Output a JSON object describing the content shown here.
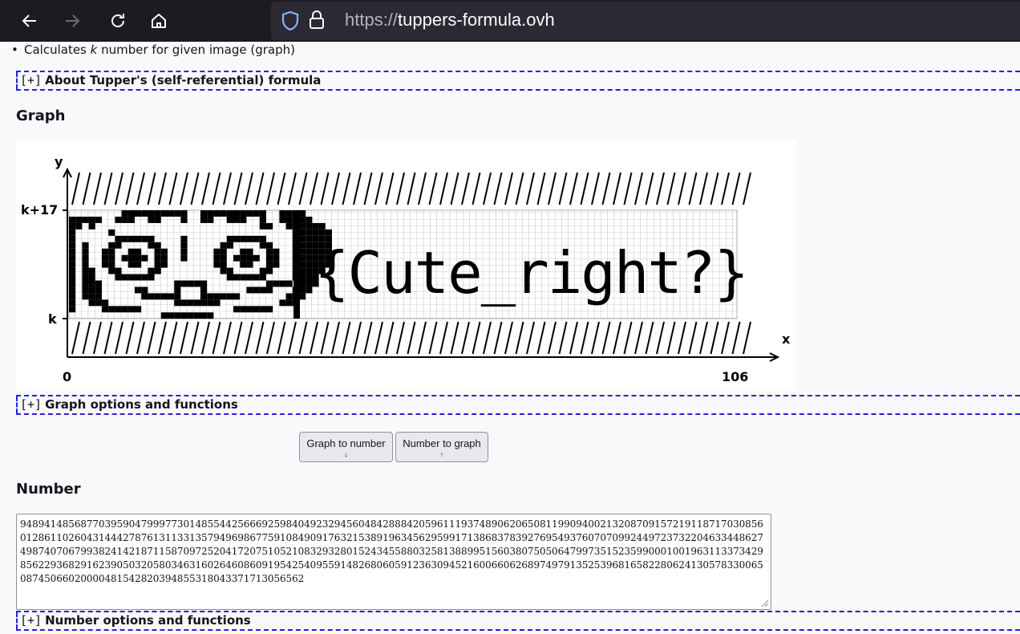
{
  "browser": {
    "url_protocol": "https://",
    "url_host": "tuppers-formula.ovh",
    "icons": [
      "back-arrow-icon",
      "forward-arrow-icon",
      "reload-icon",
      "home-icon",
      "shield-icon",
      "lock-icon"
    ]
  },
  "page": {
    "bullet_prefix": "Calculates ",
    "bullet_k": "k",
    "bullet_suffix": " number for given image (graph)",
    "toggle_symbol": "[+]",
    "about_toggle": "About Tupper's (self-referential) formula",
    "graph_heading": "Graph",
    "graph_options_toggle": "Graph options and functions",
    "graph_to_number_label": "Graph to number",
    "graph_to_number_arrow": "↓",
    "number_to_graph_label": "Number to graph",
    "number_to_graph_arrow": "↑",
    "number_heading": "Number",
    "number_value": "94894148568770395904799977301485544256669259840492329456048428884205961119374890620650811990940021320870915721911871703085601286110260431444278761311331357949698677591084909176321538919634562959917138683783927695493760707099244972373220463344862749874070679938241421871158709725204172075105210832932801524345588032581388995156038075050647997351523599000100196311337342985622936829162390503205803463160264608609195425409559148268060591236309452160066062689749791352539681658228062413057833006508745066020000481542820394855318043371713056562",
    "number_options_toggle": "Number options and functions",
    "graph_text": "{Cute_right?}",
    "colors": {
      "accent_dashed": "#2222dd",
      "toolbar_bg": "#1c1b22",
      "urlbar_bg": "#2b2a33"
    }
  },
  "graph": {
    "y_axis_label": "y",
    "x_axis_label": "x",
    "y_top_label": "k+17",
    "y_bottom_label": "k",
    "x_start_label": "0",
    "x_end_label": "106"
  }
}
